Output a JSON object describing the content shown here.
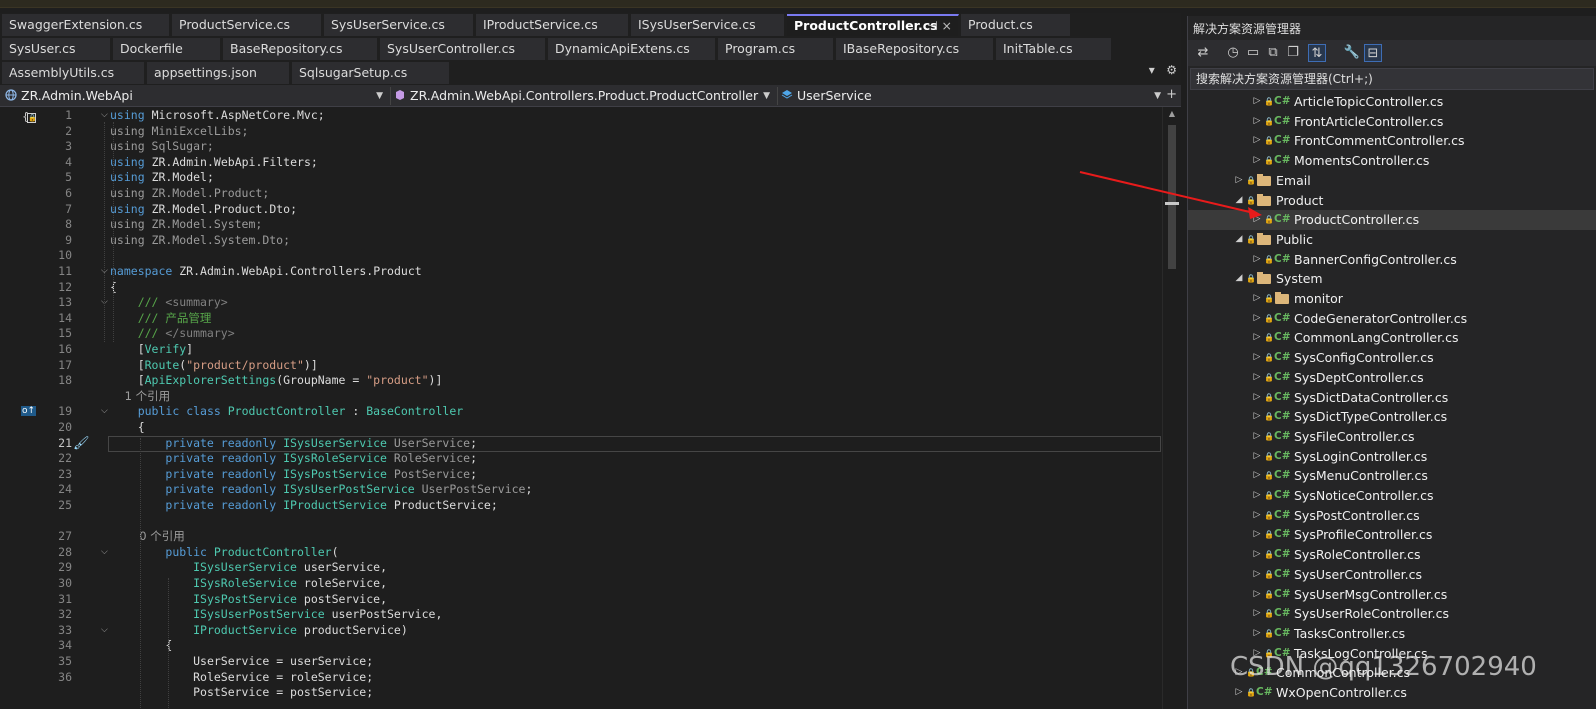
{
  "tabs_row1": [
    {
      "label": "SwaggerExtension.cs"
    },
    {
      "label": "ProductService.cs"
    },
    {
      "label": "SysUserService.cs"
    },
    {
      "label": "IProductService.cs"
    },
    {
      "label": "ISysUserService.cs"
    },
    {
      "label": "ProductController.cs",
      "active": true
    },
    {
      "label": "Product.cs"
    }
  ],
  "tabs_row2": [
    {
      "label": "SysUser.cs"
    },
    {
      "label": "Dockerfile"
    },
    {
      "label": "BaseRepository.cs"
    },
    {
      "label": "SysUserController.cs"
    },
    {
      "label": "DynamicApiExtens.cs"
    },
    {
      "label": "Program.cs"
    },
    {
      "label": "IBaseRepository.cs"
    },
    {
      "label": "InitTable.cs"
    }
  ],
  "tabs_row3": [
    {
      "label": "AssemblyUtils.cs"
    },
    {
      "label": "appsettings.json"
    },
    {
      "label": "SqlsugarSetup.cs"
    }
  ],
  "tab_tools": {
    "overflow": "▾",
    "settings": "⚙",
    "pin": "⊣",
    "close": "×"
  },
  "navbar": {
    "project": "ZR.Admin.WebApi",
    "class": "ZR.Admin.WebApi.Controllers.Product.ProductController",
    "member": "UserService"
  },
  "code": {
    "line_numbers": [
      "1",
      "2",
      "3",
      "4",
      "5",
      "6",
      "7",
      "8",
      "9",
      "10",
      "11",
      "12",
      "13",
      "14",
      "15",
      "16",
      "17",
      "18",
      "",
      "19",
      "20",
      "21",
      "22",
      "23",
      "24",
      "25",
      "",
      "27",
      "28",
      "29",
      "30",
      "31",
      "32",
      "33",
      "34",
      "35",
      "36"
    ],
    "references": {
      "class_refs": "1 个引用",
      "ctor_refs": "0 个引用"
    },
    "lines": [
      "using Microsoft.AspNetCore.Mvc;",
      "using MiniExcelLibs;",
      "using SqlSugar;",
      "using ZR.Admin.WebApi.Filters;",
      "using ZR.Model;",
      "using ZR.Model.Product;",
      "using ZR.Model.Product.Dto;",
      "using ZR.Model.System;",
      "using ZR.Model.System.Dto;",
      "",
      "namespace ZR.Admin.WebApi.Controllers.Product",
      "{",
      "    /// <summary>",
      "    /// 产品管理",
      "    /// </summary>",
      "    [Verify]",
      "    [Route(\"product/product\")]",
      "    [ApiExplorerSettings(GroupName = \"product\")]",
      "    1 个引用",
      "    public class ProductController : BaseController",
      "    {",
      "        private readonly ISysUserService UserService;",
      "        private readonly ISysRoleService RoleService;",
      "        private readonly ISysPostService PostService;",
      "        private readonly ISysUserPostService UserPostService;",
      "        private readonly IProductService ProductService;",
      "",
      "        0 个引用",
      "        public ProductController(",
      "            ISysUserService userService,",
      "            ISysRoleService roleService,",
      "            ISysPostService postService,",
      "            ISysUserPostService userPostService,",
      "            IProductService productService)",
      "        {",
      "            UserService = userService;",
      "            RoleService = roleService;",
      "            PostService = postService;"
    ]
  },
  "solution_explorer": {
    "title": "解决方案资源管理器",
    "search_placeholder": "搜索解决方案资源管理器(Ctrl+;)",
    "items": [
      {
        "label": "ArticleTopicController.cs",
        "kind": "cs",
        "indent": 2
      },
      {
        "label": "FrontArticleController.cs",
        "kind": "cs",
        "indent": 2
      },
      {
        "label": "FrontCommentController.cs",
        "kind": "cs",
        "indent": 2
      },
      {
        "label": "MomentsController.cs",
        "kind": "cs",
        "indent": 2
      },
      {
        "label": "Email",
        "kind": "folder",
        "indent": 1,
        "state": "collapsed"
      },
      {
        "label": "Product",
        "kind": "folder",
        "indent": 1,
        "state": "expanded"
      },
      {
        "label": "ProductController.cs",
        "kind": "cs",
        "indent": 2,
        "selected": true
      },
      {
        "label": "Public",
        "kind": "folder",
        "indent": 1,
        "state": "expanded"
      },
      {
        "label": "BannerConfigController.cs",
        "kind": "cs",
        "indent": 2
      },
      {
        "label": "System",
        "kind": "folder",
        "indent": 1,
        "state": "expanded"
      },
      {
        "label": "monitor",
        "kind": "folder",
        "indent": 2,
        "state": "collapsed"
      },
      {
        "label": "CodeGeneratorController.cs",
        "kind": "cs",
        "indent": 2
      },
      {
        "label": "CommonLangController.cs",
        "kind": "cs",
        "indent": 2
      },
      {
        "label": "SysConfigController.cs",
        "kind": "cs",
        "indent": 2
      },
      {
        "label": "SysDeptController.cs",
        "kind": "cs",
        "indent": 2
      },
      {
        "label": "SysDictDataController.cs",
        "kind": "cs",
        "indent": 2
      },
      {
        "label": "SysDictTypeController.cs",
        "kind": "cs",
        "indent": 2
      },
      {
        "label": "SysFileController.cs",
        "kind": "cs",
        "indent": 2
      },
      {
        "label": "SysLoginController.cs",
        "kind": "cs",
        "indent": 2
      },
      {
        "label": "SysMenuController.cs",
        "kind": "cs",
        "indent": 2
      },
      {
        "label": "SysNoticeController.cs",
        "kind": "cs",
        "indent": 2
      },
      {
        "label": "SysPostController.cs",
        "kind": "cs",
        "indent": 2
      },
      {
        "label": "SysProfileController.cs",
        "kind": "cs",
        "indent": 2
      },
      {
        "label": "SysRoleController.cs",
        "kind": "cs",
        "indent": 2
      },
      {
        "label": "SysUserController.cs",
        "kind": "cs",
        "indent": 2
      },
      {
        "label": "SysUserMsgController.cs",
        "kind": "cs",
        "indent": 2
      },
      {
        "label": "SysUserRoleController.cs",
        "kind": "cs",
        "indent": 2
      },
      {
        "label": "TasksController.cs",
        "kind": "cs",
        "indent": 2
      },
      {
        "label": "TasksLogController.cs",
        "kind": "cs",
        "indent": 2
      },
      {
        "label": "CommonController.cs",
        "kind": "cs",
        "indent": 1
      },
      {
        "label": "WxOpenController.cs",
        "kind": "cs",
        "indent": 1
      }
    ]
  },
  "watermark": "CSDN @qq1326702940",
  "colors": {
    "keyword": "#569cd6",
    "type": "#4ec9b0",
    "string": "#d69d85",
    "comment": "#57a64a",
    "arrow": "#e81b1b",
    "active_tab_accent": "#7a7af0"
  }
}
